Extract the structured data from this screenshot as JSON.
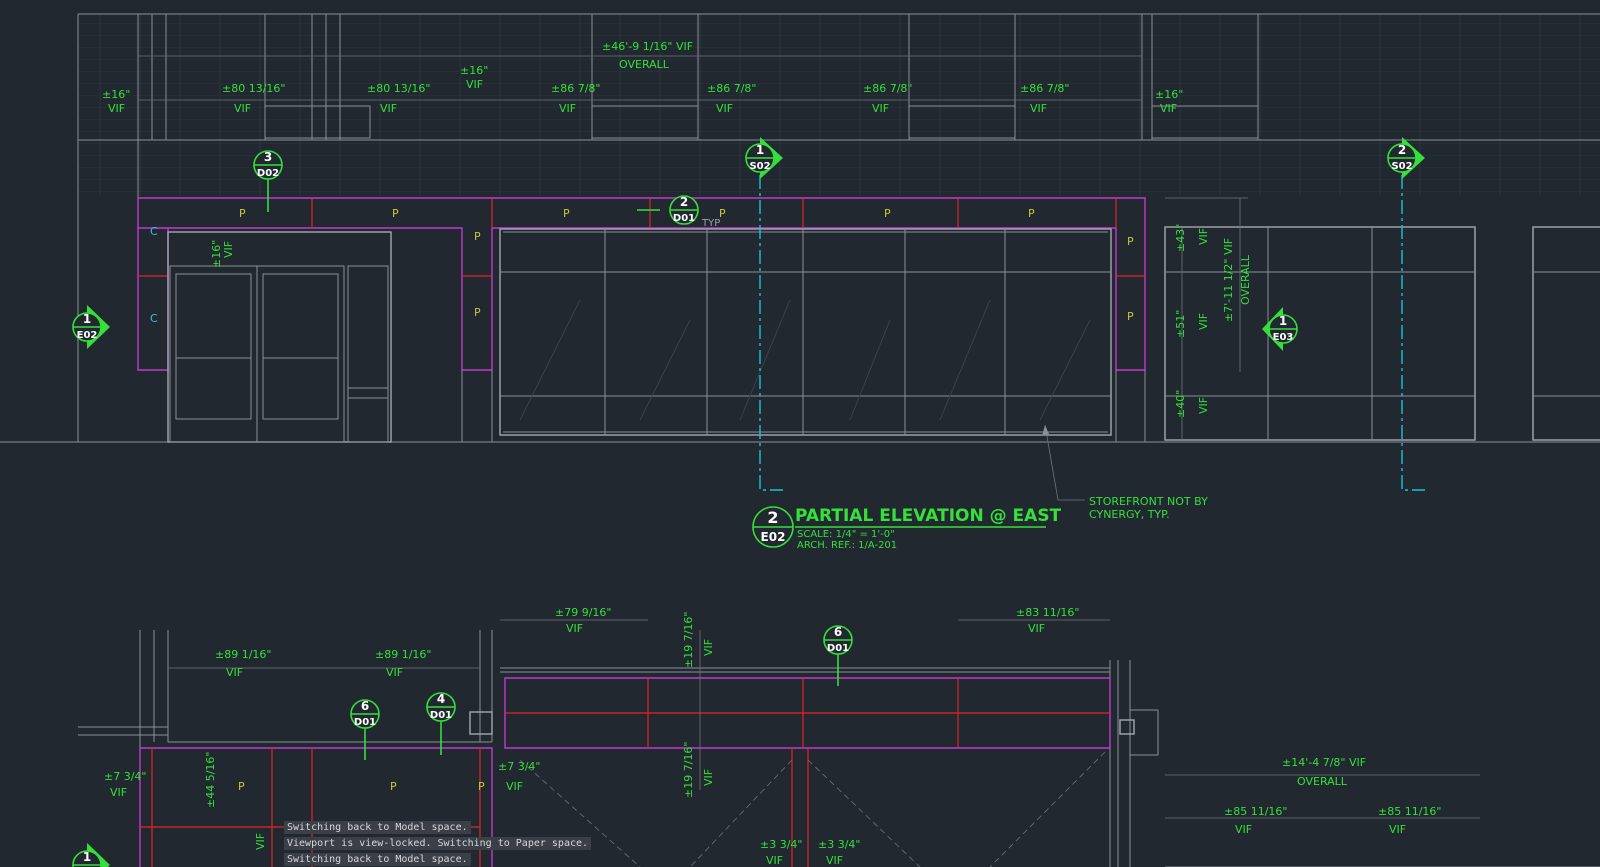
{
  "drawing": {
    "elevation": {
      "tag_number": "2",
      "tag_sheet": "E02",
      "title": "PARTIAL ELEVATION @ EAST",
      "scale": "SCALE: 1/4\" = 1'-0\"",
      "arch_ref": "ARCH. REF.: 1/A-201"
    },
    "note": {
      "line1": "STOREFRONT NOT BY",
      "line2": "CYNERGY, TYP."
    },
    "overall_top": {
      "value": "±46'-9 1/16\" VIF",
      "label": "OVERALL"
    },
    "overall_lower": {
      "value": "±14'-4 7/8\" VIF",
      "label": "OVERALL"
    },
    "overall_side": {
      "value": "±7'-11 1/2\" VIF",
      "label": "OVERALL"
    },
    "vif": "VIF",
    "typ": "TYP",
    "pier_tags": {
      "p": "P",
      "c": "C"
    },
    "dims_top": [
      {
        "v": "±16\""
      },
      {
        "v": "±80 13/16\""
      },
      {
        "v": "±80 13/16\""
      },
      {
        "v": "±16\""
      },
      {
        "v": "±86 7/8\""
      },
      {
        "v": "±86 7/8\""
      },
      {
        "v": "±86 7/8\""
      },
      {
        "v": "±86 7/8\""
      },
      {
        "v": "±16\""
      }
    ],
    "dims_side": [
      {
        "v": "±16\""
      },
      {
        "v": "±43\""
      },
      {
        "v": "±51\""
      },
      {
        "v": "±40\""
      }
    ],
    "dims_lower": [
      {
        "v": "±79 9/16\""
      },
      {
        "v": "±83 11/16\""
      },
      {
        "v": "±89 1/16\""
      },
      {
        "v": "±89 1/16\""
      },
      {
        "v": "±19 7/16\""
      },
      {
        "v": "±19 7/16\""
      },
      {
        "v": "±7 3/4\""
      },
      {
        "v": "±7 3/4\""
      },
      {
        "v": "±44 5/16\""
      },
      {
        "v": "±3 3/4\""
      },
      {
        "v": "±3 3/4\""
      },
      {
        "v": "±85 11/16\""
      },
      {
        "v": "±85 11/16\""
      }
    ],
    "callouts": [
      {
        "num": "3",
        "ref": "D02"
      },
      {
        "num": "2",
        "ref": "D01"
      },
      {
        "num": "1",
        "ref": "S02"
      },
      {
        "num": "2",
        "ref": "S02"
      },
      {
        "num": "1",
        "ref": "E02"
      },
      {
        "num": "1",
        "ref": "E03"
      },
      {
        "num": "6",
        "ref": "D01"
      },
      {
        "num": "6",
        "ref": "D01"
      },
      {
        "num": "4",
        "ref": "D01"
      },
      {
        "num": "1",
        "ref": ""
      }
    ]
  },
  "command_line": [
    "Switching back to Model space.",
    "Viewport is view-locked. Switching to Paper space.",
    "Switching back to Model space."
  ],
  "colors": {
    "background": "#212830",
    "annotation_green": "#35e03a",
    "wall_magenta": "#c03ad0",
    "grid_red": "#e0242a",
    "section_cyan": "#19c4d8"
  }
}
